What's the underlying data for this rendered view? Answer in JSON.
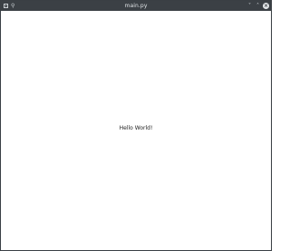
{
  "window": {
    "title": "main.py"
  },
  "titlebar": {
    "icons": {
      "app": "app-window-icon",
      "pin": "pin-icon",
      "minimize": "chevron-down-icon",
      "maximize": "chevron-up-icon",
      "close": "close-icon"
    },
    "glyphs": {
      "pin": "⚲",
      "minimize": "˅",
      "maximize": "˄",
      "close": "×"
    }
  },
  "content": {
    "label": "Hello World!"
  },
  "colors": {
    "titlebar_bg": "#3b4045",
    "window_bg": "#ffffff",
    "text": "#222222"
  }
}
